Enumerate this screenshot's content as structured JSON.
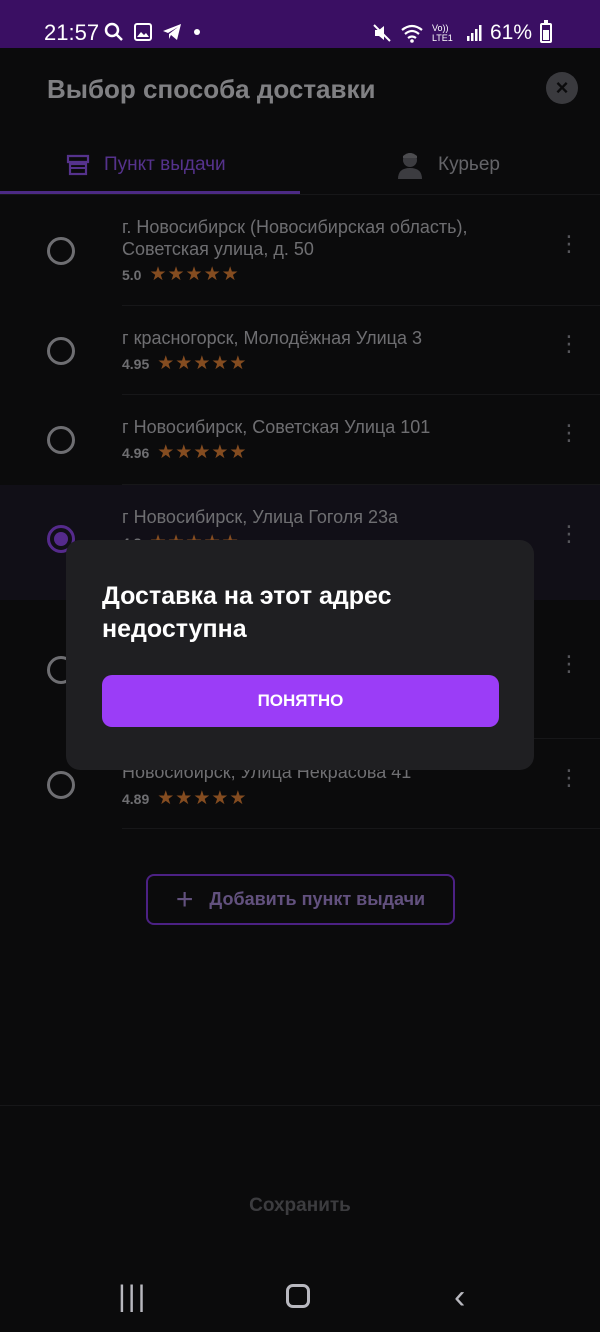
{
  "status_bar": {
    "time": "21:57",
    "battery_text": "61%",
    "battery_level": 0.61,
    "network_label": "Vo)) LTE1",
    "left_icons": [
      "search-icon",
      "image-icon",
      "telegram-icon",
      "dot-icon"
    ],
    "right_icons": [
      "mute-icon",
      "wifi-icon",
      "signal-icon",
      "battery-icon"
    ]
  },
  "header": {
    "title": "Выбор способа доставки",
    "close_icon": "close-icon"
  },
  "tabs": [
    {
      "label": "Пункт выдачи",
      "icon": "store-icon",
      "active": true
    },
    {
      "label": "Курьер",
      "icon": "courier-icon",
      "active": false
    }
  ],
  "pickup_points": [
    {
      "address": "г. Новосибирск (Новосибирская область), Советская улица, д. 50",
      "rating": "5.0",
      "stars": 5,
      "selected": false
    },
    {
      "address": "г красногорск, Молодёжная Улица 3",
      "rating": "4.95",
      "stars": 5,
      "selected": false
    },
    {
      "address": "г Новосибирск, Советская Улица 101",
      "rating": "4.96",
      "stars": 5,
      "selected": false
    },
    {
      "address": "г Новосибирск, Улица Гоголя 23а",
      "rating": "4.8",
      "stars": 5,
      "selected": true
    },
    {
      "address": "",
      "rating": "",
      "stars": 0,
      "selected": false
    },
    {
      "address": "Новосибирск, Улица Некрасова 41",
      "rating": "4.89",
      "stars": 5,
      "selected": false
    }
  ],
  "add_button": {
    "label": "Добавить пункт выдачи",
    "icon": "plus-icon"
  },
  "save_button": {
    "label": "Сохранить"
  },
  "dialog": {
    "title": "Доставка на этот адрес недоступна",
    "button_label": "ПОНЯТНО"
  },
  "navbar": {
    "icons": [
      "recent-apps-icon",
      "home-icon",
      "back-icon"
    ]
  },
  "colors": {
    "accent": "#9b3df7",
    "star": "#f08a3b",
    "status_bar": "#3a0f63"
  }
}
